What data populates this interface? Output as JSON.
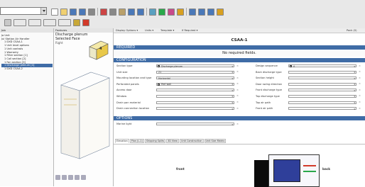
{
  "colors": {
    "header_blue": "#3f6ca6",
    "accent_green": "#2aa84a",
    "accent_red": "#d23a2a",
    "selection": "#3f6ca6"
  },
  "toolbar": {
    "icons_row1": [
      "file-icon",
      "open-icon",
      "save-icon",
      "save-all-icon",
      "print-icon",
      "cut-icon",
      "copy-icon",
      "paste-icon",
      "undo-icon",
      "redo-icon",
      "zoom-icon",
      "move-icon",
      "image-icon",
      "tag-icon",
      "grid-icon",
      "report-icon",
      "table-icon",
      "help-icon"
    ],
    "icons_row2": [
      "view-icon",
      "section-icon",
      "component-icon",
      "connect-icon",
      "drawing-icon",
      "settings-icon",
      "stop-icon"
    ]
  },
  "tree": {
    "title": "Job",
    "items": [
      "Ja Unit",
      "Jul Station Air Handler",
      "1 DXD CSAA-1",
      "1 Unit level options",
      "1 Unit controls",
      "1 Warranty",
      "1 Filter section [1]",
      "1 Coil section [2]",
      "1 Fan section [3]",
      "1 Discharge plenum [4]",
      "1 DXD CSAA-2"
    ],
    "selected_index": 9
  },
  "preview": {
    "title": "Features",
    "heading_line1": "Discharge plenum",
    "heading_line2": "Selected Face",
    "heading_line3": "Right",
    "face_number": "4"
  },
  "props": {
    "toolbar": {
      "display_options": "Display Options ▾",
      "units": "Units ▾",
      "template": "Template ▾",
      "if_required": "If Required ▾",
      "right_label": "Pack (0)"
    },
    "unit_title": "CSAA-1",
    "section_required": "REQUIRED",
    "no_required_fields": "No required fields.",
    "section_configuration": "CONFIGURATION",
    "left_fields": [
      {
        "label": "Section type",
        "value": "Discharge plenum",
        "checked": true
      },
      {
        "label": "Unit size",
        "value": "21"
      },
      {
        "label": "Mounting location and type",
        "value": "Horizontal"
      },
      {
        "label": "Perforated panels",
        "value": "Perf wall",
        "checked": true
      },
      {
        "label": "Access door",
        "value": ""
      },
      {
        "label": "Window",
        "value": ""
      },
      {
        "label": "Drain pan material",
        "value": ""
      },
      {
        "label": "Drain connection location",
        "value": ""
      }
    ],
    "right_fields": [
      {
        "label": "Design sequence",
        "value": "A",
        "checked": true
      },
      {
        "label": "Back discharge type",
        "value": ""
      },
      {
        "label": "Section height",
        "value": ""
      },
      {
        "label": "Door swing direction",
        "value": ""
      },
      {
        "label": "Front discharge type",
        "value": ""
      },
      {
        "label": "Top discharge type",
        "value": ""
      },
      {
        "label": "Top air path",
        "value": ""
      },
      {
        "label": "Front air path",
        "value": ""
      }
    ],
    "section_options": "OPTIONS",
    "options_fields": [
      {
        "label": "Marine light",
        "value": ""
      }
    ]
  },
  "bottom_tabs": [
    "Elevation",
    "Plan (L-1)",
    "Shipping Splits",
    "3D View",
    "Unit Construction",
    "Unit Size Matrix"
  ],
  "drawing": {
    "front_label": "front",
    "back_label": "back"
  }
}
